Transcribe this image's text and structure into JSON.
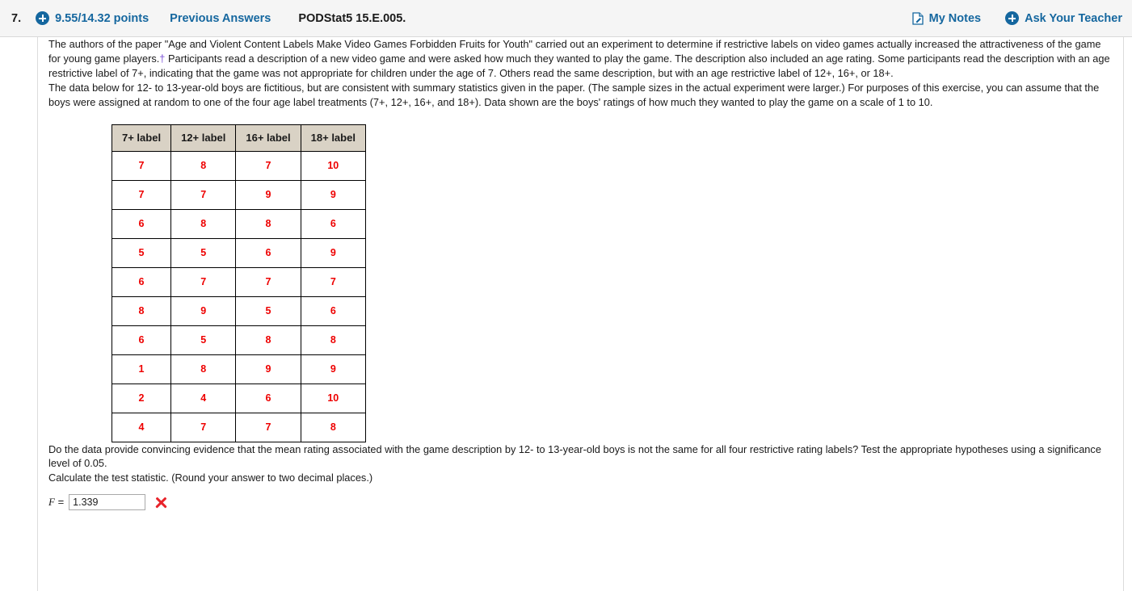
{
  "header": {
    "question_number": "7.",
    "plus_icon": "plus-circle-icon",
    "points": "9.55/14.32 points",
    "previous_answers": "Previous Answers",
    "book_tag": "PODStat5 15.E.005.",
    "notes_icon": "note-page-icon",
    "my_notes": "My Notes",
    "ask_plus_icon": "plus-circle-icon",
    "ask_your_teacher": "Ask Your Teacher"
  },
  "body": {
    "paragraph1_a": "The authors of the paper \"Age and Violent Content Labels Make Video Games Forbidden Fruits for Youth\" carried out an experiment to determine if restrictive labels on video games actually increased the attractiveness of the game for young game players.",
    "dagger": "†",
    "paragraph1_b": " Participants read a description of a new video game and were asked how much they wanted to play the game. The description also included an age rating. Some participants read the description with an age restrictive label of 7+, indicating that the game was not appropriate for children under the age of 7. Others read the same description, but with an age restrictive label of 12+, 16+, or 18+.",
    "paragraph2": "The data below for 12- to 13-year-old boys are fictitious, but are consistent with summary statistics given in the paper. (The sample sizes in the actual experiment were larger.) For purposes of this exercise, you can assume that the boys were assigned at random to one of the four age label treatments (7+, 12+, 16+, and 18+). Data shown are the boys' ratings of how much they wanted to play the game on a scale of 1 to 10.",
    "paragraph3": "Do the data provide convincing evidence that the mean rating associated with the game description by 12- to 13-year-old boys is not the same for all four restrictive rating labels? Test the appropriate hypotheses using a significance level of 0.05.",
    "paragraph4": "Calculate the test statistic. (Round your answer to two decimal places.)"
  },
  "table": {
    "headers": [
      "7+ label",
      "12+ label",
      "16+ label",
      "18+ label"
    ],
    "rows": [
      [
        "7",
        "8",
        "7",
        "10"
      ],
      [
        "7",
        "7",
        "9",
        "9"
      ],
      [
        "6",
        "8",
        "8",
        "6"
      ],
      [
        "5",
        "5",
        "6",
        "9"
      ],
      [
        "6",
        "7",
        "7",
        "7"
      ],
      [
        "8",
        "9",
        "5",
        "6"
      ],
      [
        "6",
        "5",
        "8",
        "8"
      ],
      [
        "1",
        "8",
        "9",
        "9"
      ],
      [
        "2",
        "4",
        "6",
        "10"
      ],
      [
        "4",
        "7",
        "7",
        "8"
      ]
    ]
  },
  "answer": {
    "label_symbol": "F",
    "label_equals": " =",
    "value": "1.339",
    "placeholder": "",
    "status_icon": "incorrect-x-icon"
  },
  "colors": {
    "link_blue": "#15679f",
    "table_header_bg": "#d9d2c5",
    "data_red": "#ee0000",
    "dagger_purple": "#7a4fd6",
    "incorrect_red": "#e8232a"
  }
}
